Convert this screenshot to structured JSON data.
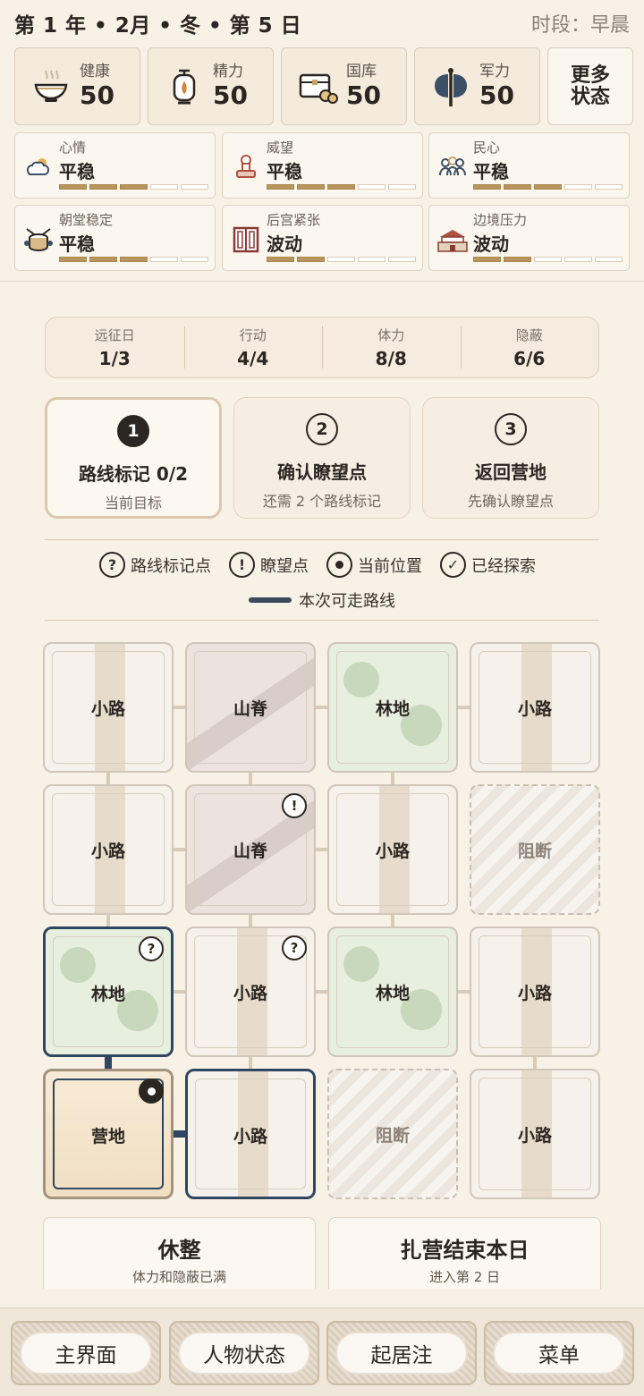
{
  "header": {
    "date": "第 1 年 • 2月 • 冬 • 第 5 日",
    "period": "时段：早晨"
  },
  "stats": [
    {
      "label": "健康",
      "value": "50",
      "icon": "rice-bowl-icon"
    },
    {
      "label": "精力",
      "value": "50",
      "icon": "lantern-icon"
    },
    {
      "label": "国库",
      "value": "50",
      "icon": "treasury-chest-icon"
    },
    {
      "label": "军力",
      "value": "50",
      "icon": "battle-axe-icon"
    }
  ],
  "more_status": "更多\n状态",
  "moods": [
    {
      "label": "心情",
      "value": "平稳",
      "level": 3,
      "icon": "weather-icon"
    },
    {
      "label": "威望",
      "value": "平稳",
      "level": 3,
      "icon": "seal-stamp-icon"
    },
    {
      "label": "民心",
      "value": "平稳",
      "level": 3,
      "icon": "people-icon"
    },
    {
      "label": "朝堂稳定",
      "value": "平稳",
      "level": 3,
      "icon": "drum-icon"
    },
    {
      "label": "后宫紧张",
      "value": "波动",
      "level": 2,
      "icon": "door-icon"
    },
    {
      "label": "边境压力",
      "value": "波动",
      "level": 2,
      "icon": "fortress-icon"
    }
  ],
  "expedition": [
    {
      "label": "远征日",
      "value": "1/3"
    },
    {
      "label": "行动",
      "value": "4/4"
    },
    {
      "label": "体力",
      "value": "8/8"
    },
    {
      "label": "隐蔽",
      "value": "6/6"
    }
  ],
  "steps": [
    {
      "num": "1",
      "title": "路线标记 0/2",
      "desc": "当前目标",
      "active": true
    },
    {
      "num": "2",
      "title": "确认瞭望点",
      "desc": "还需 2 个路线标记",
      "active": false
    },
    {
      "num": "3",
      "title": "返回营地",
      "desc": "先确认瞭望点",
      "active": false
    }
  ],
  "legend": {
    "route_mark": "路线标记点",
    "lookout": "瞭望点",
    "current": "当前位置",
    "explored": "已经探索",
    "path": "本次可走路线",
    "route_symbol": "?",
    "lookout_symbol": "!",
    "explored_symbol": "✓"
  },
  "tiles": [
    {
      "name": "小路",
      "type": "road"
    },
    {
      "name": "山脊",
      "type": "ridge"
    },
    {
      "name": "林地",
      "type": "forest"
    },
    {
      "name": "小路",
      "type": "road"
    },
    {
      "name": "小路",
      "type": "road"
    },
    {
      "name": "山脊",
      "type": "ridge",
      "marker": "!"
    },
    {
      "name": "小路",
      "type": "road"
    },
    {
      "name": "阻断",
      "type": "blocked"
    },
    {
      "name": "林地",
      "type": "forest",
      "marker": "?",
      "highlight": true
    },
    {
      "name": "小路",
      "type": "road",
      "marker": "?"
    },
    {
      "name": "林地",
      "type": "forest"
    },
    {
      "name": "小路",
      "type": "road"
    },
    {
      "name": "营地",
      "type": "camp",
      "marker": "current"
    },
    {
      "name": "小路",
      "type": "road",
      "highlight": true
    },
    {
      "name": "阻断",
      "type": "blocked"
    },
    {
      "name": "小路",
      "type": "road"
    }
  ],
  "actions": [
    {
      "title": "休整",
      "desc": "体力和隐蔽已满"
    },
    {
      "title": "扎营结束本日",
      "desc": "进入第 2 日"
    }
  ],
  "nav": [
    "主界面",
    "人物状态",
    "起居注",
    "菜单"
  ],
  "colors": {
    "accent": "#2f4660",
    "bar_fill": "#b8955a",
    "forest": "#e7efdf"
  }
}
